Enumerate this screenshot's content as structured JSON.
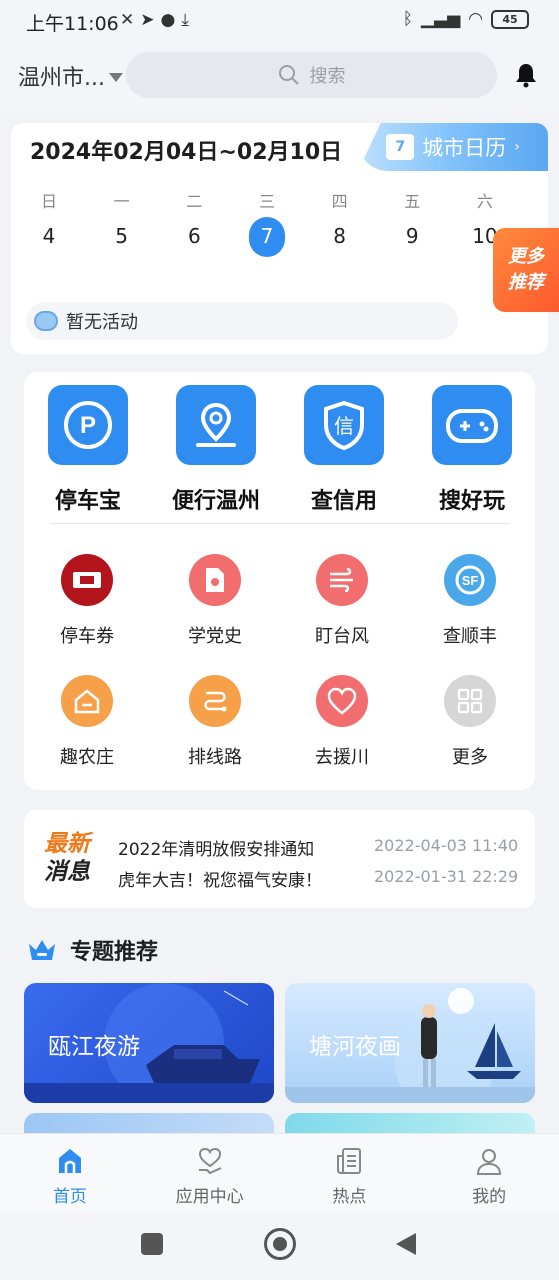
{
  "status_bar": {
    "time": "上午11:06",
    "battery": "45"
  },
  "header": {
    "city": "温州市...",
    "search_placeholder": "搜索"
  },
  "calendar": {
    "range": "2024年02月04日~02月10日",
    "city_calendar_label": "城市日历",
    "weekdays": [
      "日",
      "一",
      "二",
      "三",
      "四",
      "五",
      "六"
    ],
    "days": [
      "4",
      "5",
      "6",
      "7",
      "8",
      "9",
      "10"
    ],
    "today_index": 3,
    "no_activity": "暂无活动",
    "more_recommend": [
      "更多",
      "推荐"
    ]
  },
  "big_apps": [
    {
      "label": "停车宝",
      "icon": "parking-icon"
    },
    {
      "label": "便行温州",
      "icon": "location-map-icon"
    },
    {
      "label": "查信用",
      "icon": "credit-shield-icon"
    },
    {
      "label": "搜好玩",
      "icon": "gamepad-icon"
    }
  ],
  "small_apps": [
    {
      "label": "停车券",
      "icon": "parking-ticket-icon",
      "color": "#b3141b"
    },
    {
      "label": "学党史",
      "icon": "party-history-icon",
      "color": "#f26d6d"
    },
    {
      "label": "盯台风",
      "icon": "typhoon-icon",
      "color": "#f26d6d"
    },
    {
      "label": "查顺丰",
      "icon": "sf-express-icon",
      "color": "#4aa8ea"
    },
    {
      "label": "趣农庄",
      "icon": "farm-house-icon",
      "color": "#f7a04a"
    },
    {
      "label": "排线路",
      "icon": "route-icon",
      "color": "#f7a04a"
    },
    {
      "label": "去援川",
      "icon": "heart-aid-icon",
      "color": "#f26d6d"
    },
    {
      "label": "更多",
      "icon": "grid-more-icon",
      "color": "#d0d0d0"
    }
  ],
  "news": {
    "badge_line1": "最新",
    "badge_line2": "消息",
    "items": [
      {
        "title": "2022年清明放假安排通知",
        "date": "2022-04-03 11:40"
      },
      {
        "title": "虎年大吉！祝您福气安康！",
        "date": "2022-01-31 22:29"
      }
    ]
  },
  "topics": {
    "header": "专题推荐",
    "items": [
      {
        "title": "瓯江夜游"
      },
      {
        "title": "塘河夜画"
      }
    ]
  },
  "bottom_nav": [
    {
      "label": "首页",
      "icon": "home-icon",
      "active": true
    },
    {
      "label": "应用中心",
      "icon": "heart-hand-icon",
      "active": false
    },
    {
      "label": "热点",
      "icon": "news-doc-icon",
      "active": false
    },
    {
      "label": "我的",
      "icon": "user-icon",
      "active": false
    }
  ]
}
